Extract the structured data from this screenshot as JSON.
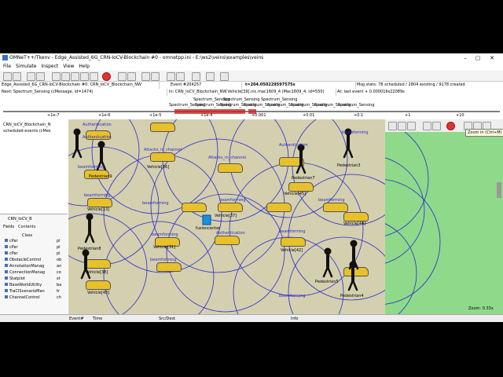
{
  "window": {
    "title": "OMNeT++/Tkenv - Edge_Assisted_6G_CRN-IoCV-Blockchain #0 - omnetpp.ini - E:\\ws2\\veins\\examples\\veins",
    "minimize": "–",
    "maximize": "▢",
    "close": "✕"
  },
  "menu": [
    "File",
    "Simulate",
    "Inspect",
    "View",
    "Help"
  ],
  "info": {
    "network": "Edge_Assisted_6G_CRN-IoCV-Blockchain #0: CRN_IoCV_Blockchain_NW",
    "event": "Event #204257",
    "time": "t=204.050229597575s",
    "msgstats": "Msg stats: 78 scheduled / 2804 existing / 9178 created",
    "next": "Next: Spectrum_Sensing (cMessage, id=1474)",
    "in": "In: CRN_IoCV_Blockchain_NW.Vehicle[39].nic.mac1609_4 (Mac1609_4, id=550)",
    "lastevent": "At: last event + 0.000016s22089s"
  },
  "timeline": {
    "labels": [
      "Spectrum_Sensing",
      "Spectrum_Sensing",
      "Spectrum_Sensing",
      "Spectrum_Sensing",
      "Spectrum_Sensing",
      "Spectrum_Sensing",
      "Spectrum_Sensing",
      "Spectrum_Sensing",
      "Spectrum_Sensing",
      "Spectrum_Sensing",
      "Spectrum_Sensing"
    ],
    "ticks": [
      "+1e-7",
      "+1e-6",
      "+1e-5",
      "+1e-4",
      "+0.001",
      "+0.01",
      "+0.1",
      "+1",
      "+10"
    ]
  },
  "tree": {
    "items": [
      "CRN_IoCV_Blockchain_N",
      "scheduled-events (cMes"
    ]
  },
  "inspector": {
    "title": "CRN_IoCV_B",
    "tabs": [
      "Fields",
      "Contents"
    ],
    "column": "Class",
    "rows": [
      "cPar",
      "cPar",
      "cPar",
      "ObstacleControl",
      "AnnotationManag",
      "ConnectionManag",
      "Statplot",
      "BaseWorldUtility",
      "TraCIScenarioMan",
      "ChannelControl"
    ],
    "values": [
      "pl",
      "pl",
      "pl",
      "ob",
      "an",
      "co",
      "st",
      "ba",
      "tr",
      "ch"
    ]
  },
  "canvas": {
    "labels": [
      {
        "t": "Authentication",
        "kind": "blue"
      },
      {
        "t": "Authentication",
        "kind": "blue"
      },
      {
        "t": "Attacks_in_channel",
        "kind": "blue"
      },
      {
        "t": "Attacks_in_channel",
        "kind": "blue"
      },
      {
        "t": "beamforming",
        "kind": "blue"
      },
      {
        "t": "beamforming",
        "kind": "blue"
      },
      {
        "t": "beamforming",
        "kind": "blue"
      },
      {
        "t": "beamforming",
        "kind": "blue"
      },
      {
        "t": "Authentication",
        "kind": "blue"
      },
      {
        "t": "beamforming",
        "kind": "blue"
      },
      {
        "t": "beamforming",
        "kind": "blue"
      },
      {
        "t": "beamforming",
        "kind": "blue"
      },
      {
        "t": "Authentication",
        "kind": "blue"
      },
      {
        "t": "beamforming",
        "kind": "blue"
      },
      {
        "t": "beamforming",
        "kind": "blue"
      },
      {
        "t": "beamforming",
        "kind": "blue"
      },
      {
        "t": "fusioncenter",
        "kind": "black"
      },
      {
        "t": "Pedestrian8",
        "kind": "black"
      },
      {
        "t": "Pedestrian9",
        "kind": "black"
      },
      {
        "t": "Pedestrian7",
        "kind": "black"
      },
      {
        "t": "Pedestrian3",
        "kind": "black"
      },
      {
        "t": "Pedestrian5",
        "kind": "black"
      },
      {
        "t": "Pedestrian4",
        "kind": "black"
      },
      {
        "t": "Vehicle[36]",
        "kind": "black"
      },
      {
        "t": "Vehicle[13]",
        "kind": "black"
      },
      {
        "t": "Vehicle[31]",
        "kind": "black"
      },
      {
        "t": "Vehicle[37]",
        "kind": "black"
      },
      {
        "t": "Vehicle[38]",
        "kind": "black"
      },
      {
        "t": "Vehicle[42]",
        "kind": "black"
      },
      {
        "t": "Vehicle[43]",
        "kind": "black"
      },
      {
        "t": "Vehicle[44]",
        "kind": "black"
      },
      {
        "t": "Vehicle[45]",
        "kind": "black"
      }
    ]
  },
  "zoom": {
    "tooltip": "Zoom in (Ctrl+M)",
    "level": "Zoom: 0.33x"
  },
  "bottom": {
    "cols": [
      "Event#",
      "Time",
      "Src/Dest",
      "Info"
    ]
  }
}
